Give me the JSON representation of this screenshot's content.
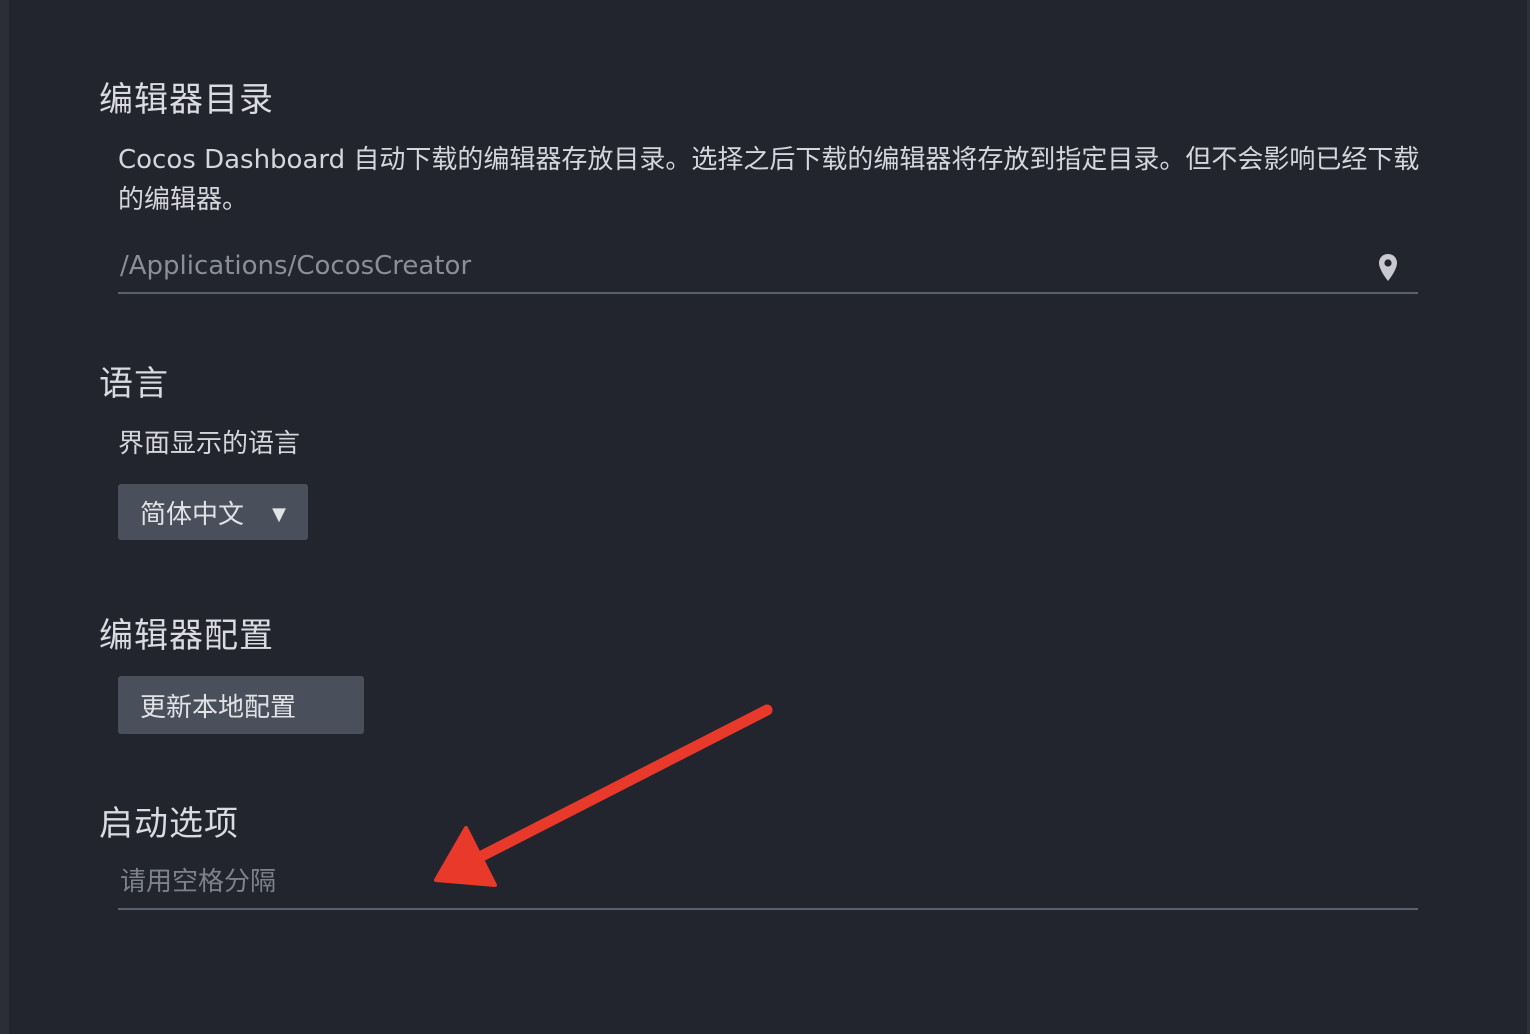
{
  "editor_dir": {
    "title": "编辑器目录",
    "description": "Cocos Dashboard 自动下载的编辑器存放目录。选择之后下载的编辑器将存放到指定目录。但不会影响已经下载的编辑器。",
    "path_value": "/Applications/CocosCreator",
    "browse_icon": "location-pin-icon"
  },
  "language": {
    "title": "语言",
    "description": "界面显示的语言",
    "selected": "简体中文",
    "caret": "▼"
  },
  "editor_config": {
    "title": "编辑器配置",
    "update_button": "更新本地配置"
  },
  "launch_options": {
    "title": "启动选项",
    "placeholder": "请用空格分隔"
  },
  "annotation": {
    "color": "#e8392b"
  }
}
